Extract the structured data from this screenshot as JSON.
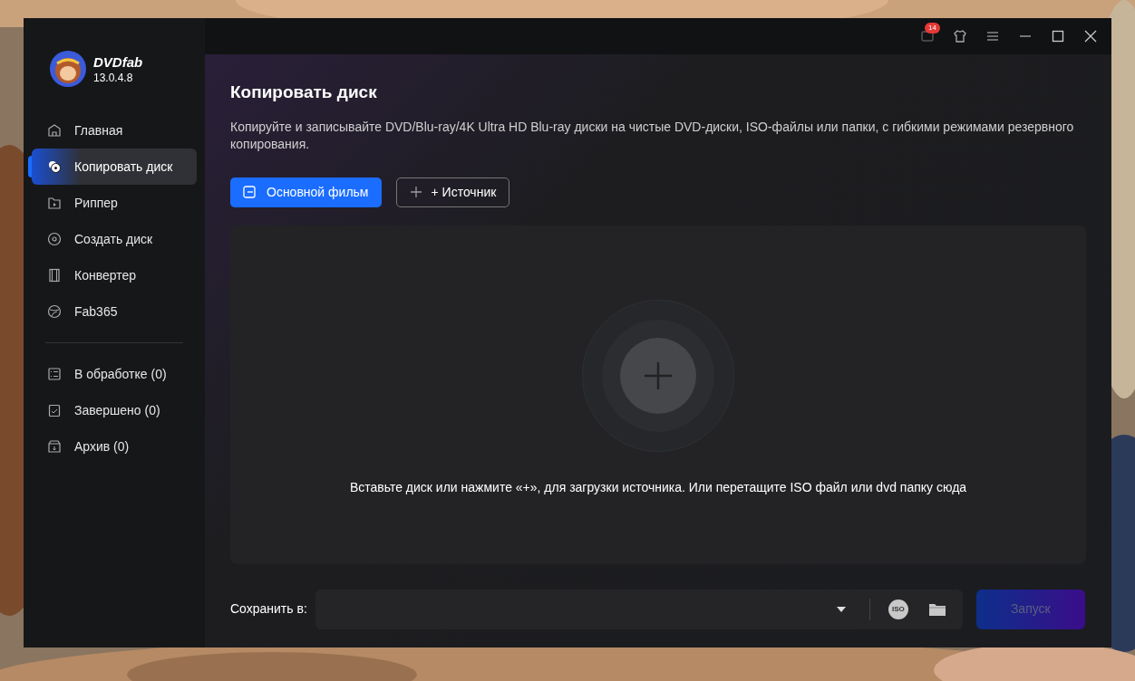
{
  "app": {
    "name": "DVDfab",
    "version": "13.0.4.8"
  },
  "title_bar": {
    "notification_count": "14"
  },
  "sidebar": {
    "items": [
      {
        "kind": "home",
        "label": "Главная",
        "selected": false
      },
      {
        "kind": "copy",
        "label": "Копировать диск",
        "selected": true
      },
      {
        "kind": "ripper",
        "label": "Риппер",
        "selected": false
      },
      {
        "kind": "create",
        "label": "Создать диск",
        "selected": false
      },
      {
        "kind": "converter",
        "label": "Конвертер",
        "selected": false
      },
      {
        "kind": "fab365",
        "label": "Fab365",
        "selected": false
      }
    ],
    "queues": [
      {
        "kind": "processing",
        "label": "В обработке (0)"
      },
      {
        "kind": "done",
        "label": "Завершено (0)"
      },
      {
        "kind": "archive",
        "label": "Архив (0)"
      }
    ]
  },
  "page": {
    "title": "Копировать диск",
    "description": "Копируйте и записывайте DVD/Blu-ray/4K Ultra HD Blu-ray диски на чистые DVD-диски, ISO-файлы или папки, с гибкими режимами резервного копирования.",
    "mode_button": "Основной фильм",
    "source_button": "+ Источник",
    "drop_hint": "Вставьте диск или нажмите «+», для загрузки источника. Или перетащите ISO файл или dvd папку сюда"
  },
  "footer": {
    "save_label": "Сохранить в:",
    "iso_icon_text": "ISO",
    "start_button": "Запуск",
    "start_disabled": true
  }
}
